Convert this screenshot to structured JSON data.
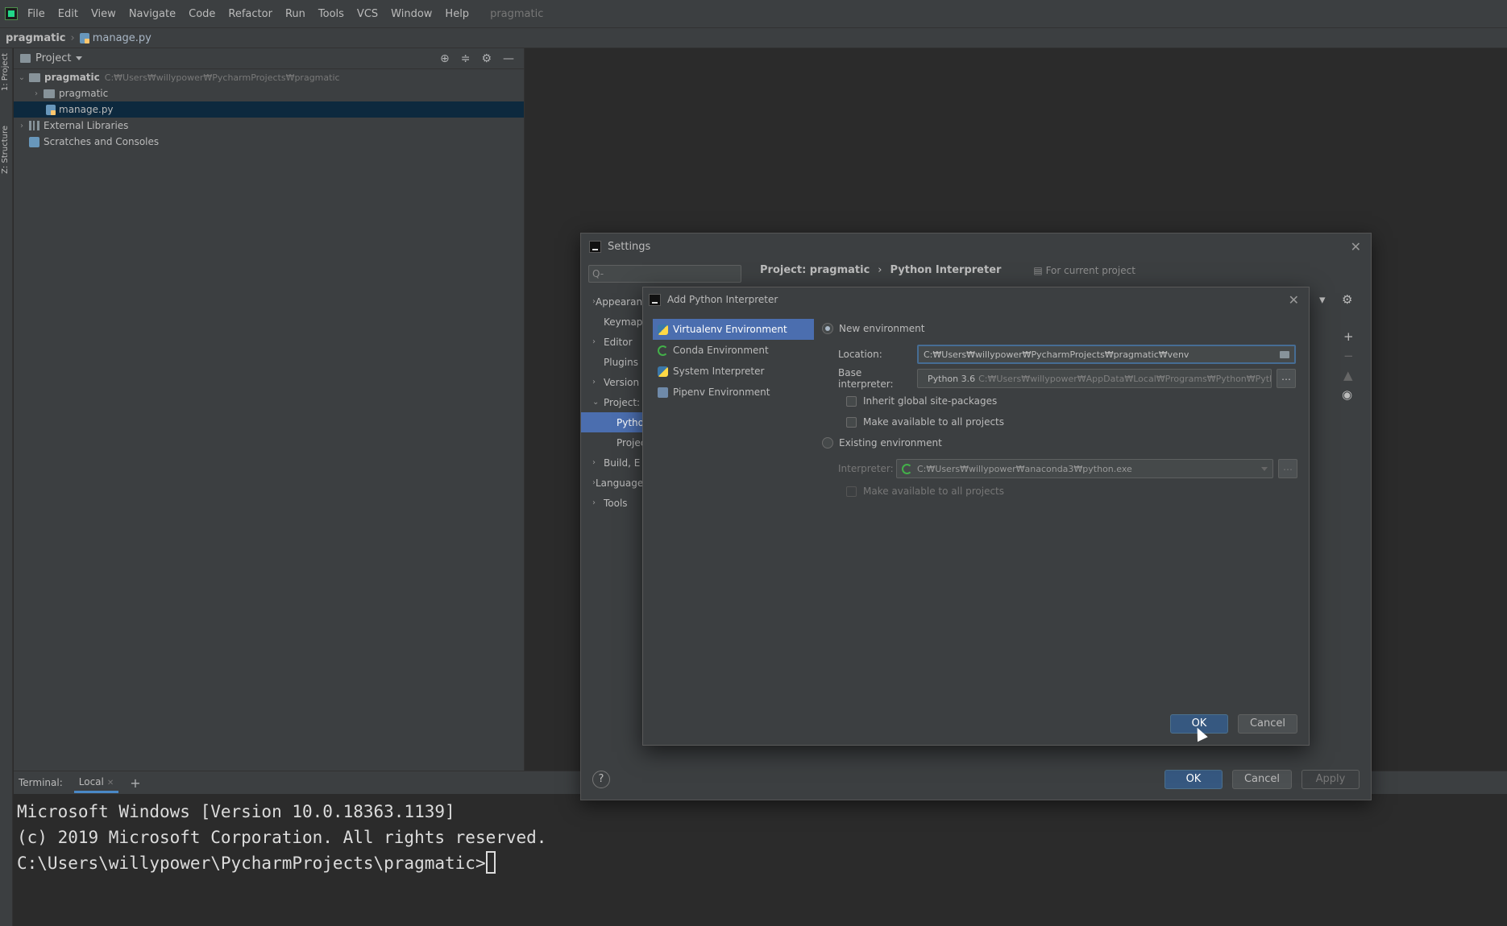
{
  "menubar": {
    "items": [
      "File",
      "Edit",
      "View",
      "Navigate",
      "Code",
      "Refactor",
      "Run",
      "Tools",
      "VCS",
      "Window",
      "Help"
    ],
    "project": "pragmatic"
  },
  "navbar": {
    "root": "pragmatic",
    "file": "manage.py"
  },
  "toolstripe": {
    "project_tab": "1: Project",
    "structure_tab": "Z: Structure"
  },
  "project_panel": {
    "title": "Project",
    "tree": {
      "root_name": "pragmatic",
      "root_path": "C:₩Users₩willypower₩PycharmProjects₩pragmatic",
      "folder": "pragmatic",
      "file": "manage.py",
      "external_libraries": "External Libraries",
      "scratches": "Scratches and Consoles"
    }
  },
  "terminal": {
    "label": "Terminal:",
    "tab": "Local",
    "lines": [
      "Microsoft Windows [Version 10.0.18363.1139]",
      "(c) 2019 Microsoft Corporation. All rights reserved.",
      "",
      "C:\\Users\\willypower\\PycharmProjects\\pragmatic>"
    ]
  },
  "settings": {
    "title": "Settings",
    "search_placeholder": "Q-",
    "crumb_project": "Project: pragmatic",
    "crumb_page": "Python Interpreter",
    "crumb_note": "For current project",
    "left_items": [
      "Appearance",
      "Keymap",
      "Editor",
      "Plugins",
      "Version",
      "Project:",
      "Python",
      "Project",
      "Build, E",
      "Languages",
      "Tools"
    ],
    "ok": "OK",
    "cancel": "Cancel",
    "apply": "Apply"
  },
  "add_interpreter": {
    "title": "Add Python Interpreter",
    "env_types": [
      "Virtualenv Environment",
      "Conda Environment",
      "System Interpreter",
      "Pipenv Environment"
    ],
    "new_env_label": "New environment",
    "location_label": "Location:",
    "location_value": "C:₩Users₩willypower₩PycharmProjects₩pragmatic₩venv",
    "base_interp_label": "Base interpreter:",
    "base_interp_value": "Python 3.6",
    "base_interp_path": "C:₩Users₩willypower₩AppData₩Local₩Programs₩Python₩Pythc",
    "inherit_label": "Inherit global site-packages",
    "make_available_label": "Make available to all projects",
    "existing_env_label": "Existing environment",
    "interpreter_label": "Interpreter:",
    "interpreter_value": "C:₩Users₩willypower₩anaconda3₩python.exe",
    "make_available_label_2": "Make available to all projects",
    "ok": "OK",
    "cancel": "Cancel"
  }
}
